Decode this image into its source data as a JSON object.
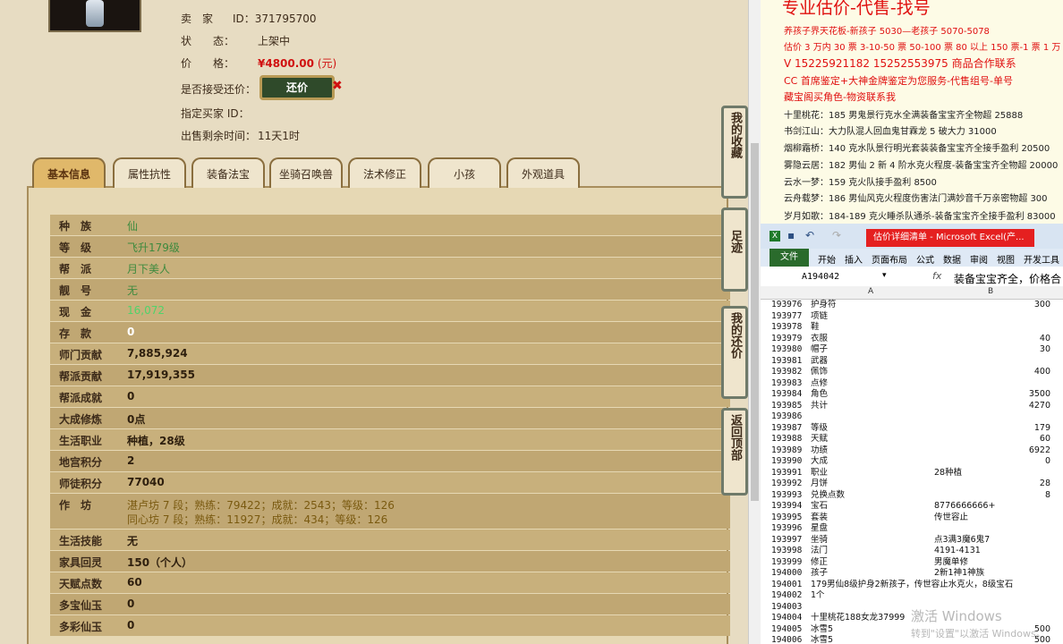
{
  "seller": {
    "label": "卖　家",
    "id_label": "ID：",
    "id": "371795700"
  },
  "status": {
    "label": "状　　态：",
    "value": "上架中"
  },
  "price": {
    "label": "价　　格：",
    "value": "¥4800.00",
    "unit": "(元)"
  },
  "counter_offer": {
    "label": "是否接受还价：",
    "button": "还价"
  },
  "buyer": {
    "label": "指定买家 ID："
  },
  "remaining": {
    "label": "出售剩余时间：",
    "value": "11天1时"
  },
  "tabs": [
    "基本信息",
    "属性抗性",
    "装备法宝",
    "坐骑召唤兽",
    "法术修正",
    "小孩",
    "外观道具"
  ],
  "stats": [
    {
      "k": "种　族",
      "v": "仙",
      "style": "green"
    },
    {
      "k": "等　级",
      "v": "飞升179级",
      "style": "green"
    },
    {
      "k": "帮　派",
      "v": "月下美人",
      "style": "green"
    },
    {
      "k": "靓　号",
      "v": "无",
      "style": "green"
    },
    {
      "k": "现　金",
      "v": "16,072",
      "style": "green"
    },
    {
      "k": "存　款",
      "v": "0",
      "style": "white"
    },
    {
      "k": "师门贡献",
      "v": "7,885,924"
    },
    {
      "k": "帮派贡献",
      "v": "17,919,355"
    },
    {
      "k": "帮派成就",
      "v": "0"
    },
    {
      "k": "大成修炼",
      "v": "0点"
    },
    {
      "k": "生活职业",
      "v": "种植，28级"
    },
    {
      "k": "地宫积分",
      "v": "2"
    },
    {
      "k": "师徒积分",
      "v": "77040"
    }
  ],
  "workshop": {
    "k": "作　坊",
    "line1": "湛卢坊 7 段；熟练：79422；成就：2543；等级：126",
    "line2": "同心坊 7 段；熟练：11927；成就：434；等级：126"
  },
  "stats2": [
    {
      "k": "生活技能",
      "v": "无"
    },
    {
      "k": "家具回灵",
      "v": "150（个人）"
    },
    {
      "k": "天赋点数",
      "v": "60"
    },
    {
      "k": "多宝仙玉",
      "v": "0"
    },
    {
      "k": "多彩仙玉",
      "v": "0"
    }
  ],
  "side_buttons": [
    "我的收藏",
    "足迹",
    "我的还价",
    "返回顶部"
  ],
  "ad": {
    "title": "专业估价-代售-找号",
    "lines": [
      {
        "text": "养孩子界天花板-新孩子 5030—老孩子 5070-5078",
        "color": "red"
      },
      {
        "text": "估价 3 万内 30 票  3-10-50 票 50-100 票 80 以上 150 票-1 票 1 万",
        "color": "red"
      },
      {
        "text": "V 15225921182    15252553975  商品合作联系",
        "color": "red"
      },
      {
        "text": "CC 首席鉴定+大神金牌鉴定为您服务-代售组号-单号",
        "color": "red"
      },
      {
        "text": "藏宝阁买角色-物资联系我",
        "color": "red"
      },
      {
        "text": "十里桃花：185 男鬼景行克水全满装备宝宝齐全物超 25888",
        "color": "dark"
      },
      {
        "text": "书剑江山：大力队混人回血鬼甘霖龙 5 破大力 31000",
        "color": "dark"
      },
      {
        "text": "烟柳霜桥：140 克水队景行明光套装装备宝宝齐全接手盈利 20500",
        "color": "dark"
      },
      {
        "text": "雾隐云居：182 男仙 2 新 4 阶水克火程度-装备宝宝齐全物超 20000",
        "color": "dark"
      },
      {
        "text": "云水一梦：159 克火队接手盈利 8500",
        "color": "dark"
      },
      {
        "text": "云舟载梦：186 男仙风克火程度伤害法门满妙音千万亲密物超 300",
        "color": "dark"
      },
      {
        "text": "岁月如歌：184-189 克火睡杀队通杀-装备宝宝齐全接手盈利 83000",
        "color": "dark"
      }
    ]
  },
  "excel": {
    "title": "估价详细清单 - Microsoft Excel(产...",
    "ribbon": [
      "开始",
      "插入",
      "页面布局",
      "公式",
      "数据",
      "审阅",
      "视图",
      "开发工具"
    ],
    "file_tab": "文件",
    "cell_ref": "A194042",
    "formula": "装备宝宝齐全，价格合",
    "col_a": "A",
    "col_b": "B",
    "rows": [
      {
        "n": "193976",
        "a": "护身符",
        "b": "300",
        "num": true
      },
      {
        "n": "193977",
        "a": "项链",
        "b": ""
      },
      {
        "n": "193978",
        "a": "鞋",
        "b": ""
      },
      {
        "n": "193979",
        "a": "衣服",
        "b": "40",
        "num": true
      },
      {
        "n": "193980",
        "a": "帽子",
        "b": "30",
        "num": true
      },
      {
        "n": "193981",
        "a": "武器",
        "b": ""
      },
      {
        "n": "193982",
        "a": "佩饰",
        "b": "400",
        "num": true
      },
      {
        "n": "193983",
        "a": "点修",
        "b": ""
      },
      {
        "n": "193984",
        "a": "角色",
        "b": "3500",
        "num": true
      },
      {
        "n": "193985",
        "a": "共计",
        "b": "4270",
        "num": true
      },
      {
        "n": "193986",
        "a": "",
        "b": ""
      },
      {
        "n": "193987",
        "a": "等级",
        "b": "179",
        "num": true
      },
      {
        "n": "193988",
        "a": "天赋",
        "b": "60",
        "num": true
      },
      {
        "n": "193989",
        "a": "功绩",
        "b": "6922",
        "num": true
      },
      {
        "n": "193990",
        "a": "大成",
        "b": "0",
        "num": true
      },
      {
        "n": "193991",
        "a": "职业",
        "b": "28种植"
      },
      {
        "n": "193992",
        "a": "月饼",
        "b": "28",
        "num": true
      },
      {
        "n": "193993",
        "a": "兑换点数",
        "b": "8",
        "num": true
      },
      {
        "n": "193994",
        "a": "宝石",
        "b": "8776666666+"
      },
      {
        "n": "193995",
        "a": "套装",
        "b": "传世容止"
      },
      {
        "n": "193996",
        "a": "星盘",
        "b": ""
      },
      {
        "n": "193997",
        "a": "坐骑",
        "b": "点3满3魔6鬼7"
      },
      {
        "n": "193998",
        "a": "法门",
        "b": "4191-4131"
      },
      {
        "n": "193999",
        "a": "修正",
        "b": "男魔单修"
      },
      {
        "n": "194000",
        "a": "孩子",
        "b": "2新1神1神族"
      },
      {
        "n": "194001",
        "a": "179男仙8级护身2新孩子，传世容止水克火，8级宝石",
        "b": ""
      },
      {
        "n": "194002",
        "a": "1个",
        "b": ""
      },
      {
        "n": "194003",
        "a": "",
        "b": ""
      },
      {
        "n": "194004",
        "a": "十里桃花188女龙37999",
        "b": ""
      },
      {
        "n": "194005",
        "a": "冰雪5",
        "b": "500",
        "num": true
      },
      {
        "n": "194006",
        "a": "冰雪5",
        "b": "500",
        "num": true
      }
    ]
  },
  "watermark": {
    "line1": "激活 Windows",
    "line2": "转到\"设置\"以激活 Windows。"
  }
}
